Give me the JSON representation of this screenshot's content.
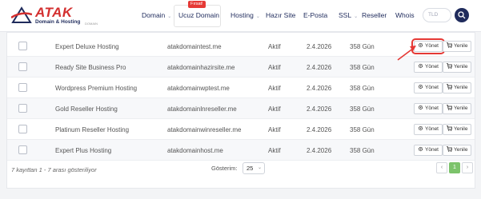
{
  "header": {
    "logo_text": "ATAK",
    "logo_sub": "Domain & Hosting",
    "logo_tiny": "DOMAIN",
    "nav": [
      {
        "label": "Domain",
        "has_chevron": true
      },
      {
        "label": "Ucuz Domain",
        "badge": "Fırsat!"
      },
      {
        "label": "Hosting",
        "has_chevron": true
      },
      {
        "label": "Hazır Site"
      },
      {
        "label": "E-Posta"
      },
      {
        "label": "SSL",
        "has_chevron": true
      },
      {
        "label": "Reseller"
      },
      {
        "label": "Whois"
      }
    ],
    "search_placeholder": "TLD"
  },
  "table": {
    "rows": [
      {
        "name": "Expert Deluxe Hosting",
        "domain": "atakdomaintest.me",
        "status": "Aktif",
        "date": "2.4.2026",
        "days": "358 Gün"
      },
      {
        "name": "Ready Site Business Pro",
        "domain": "atakdomainhazirsite.me",
        "status": "Aktif",
        "date": "2.4.2026",
        "days": "358 Gün"
      },
      {
        "name": "Wordpress Premium Hosting",
        "domain": "atakdomainwptest.me",
        "status": "Aktif",
        "date": "2.4.2026",
        "days": "358 Gün"
      },
      {
        "name": "Gold Reseller Hosting",
        "domain": "atakdomainlnreseller.me",
        "status": "Aktif",
        "date": "2.4.2026",
        "days": "358 Gün"
      },
      {
        "name": "Platinum Reseller Hosting",
        "domain": "atakdomainwinreseller.me",
        "status": "Aktif",
        "date": "2.4.2026",
        "days": "358 Gün"
      },
      {
        "name": "Expert Plus Hosting",
        "domain": "atakdomainhost.me",
        "status": "Aktif",
        "date": "2.4.2026",
        "days": "358 Gün"
      }
    ],
    "manage_label": "Yönet",
    "renew_label": "Yenile"
  },
  "footer": {
    "summary": "7 kayıttan 1 - 7 arası gösteriliyor",
    "per_page_label": "Gösterim:",
    "per_page_value": "25",
    "current_page": "1",
    "prev": "‹",
    "next": "›"
  },
  "colors": {
    "brand_red": "#d32f2f",
    "brand_navy": "#1f2b5c",
    "highlight": "#e53935",
    "pager_active": "#7cc36b"
  }
}
